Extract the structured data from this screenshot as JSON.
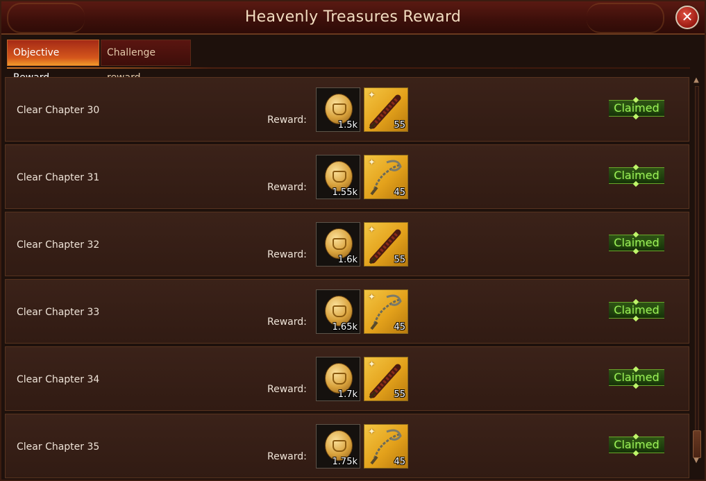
{
  "window": {
    "title": "Heavenly Treasures Reward",
    "close_icon": "close-icon"
  },
  "tabs": [
    {
      "label": "Objective Reward",
      "active": true
    },
    {
      "label": "Challenge reward",
      "active": false
    }
  ],
  "reward_label": "Reward:",
  "rows": [
    {
      "title": "Clear Chapter 30",
      "coin_amount": "1.5k",
      "weapon": "spiked-club",
      "weapon_count": "55",
      "status": "Claimed"
    },
    {
      "title": "Clear Chapter 31",
      "coin_amount": "1.55k",
      "weapon": "chain-flail",
      "weapon_count": "45",
      "status": "Claimed"
    },
    {
      "title": "Clear Chapter 32",
      "coin_amount": "1.6k",
      "weapon": "spiked-club",
      "weapon_count": "55",
      "status": "Claimed"
    },
    {
      "title": "Clear Chapter 33",
      "coin_amount": "1.65k",
      "weapon": "chain-flail",
      "weapon_count": "45",
      "status": "Claimed"
    },
    {
      "title": "Clear Chapter 34",
      "coin_amount": "1.7k",
      "weapon": "spiked-club",
      "weapon_count": "55",
      "status": "Claimed"
    },
    {
      "title": "Clear Chapter 35",
      "coin_amount": "1.75k",
      "weapon": "chain-flail",
      "weapon_count": "45",
      "status": "Claimed"
    }
  ],
  "colors": {
    "claimed_text": "#9ef25a",
    "active_tab": "#d4561c",
    "weapon_slot_bg": "#f4c542"
  }
}
